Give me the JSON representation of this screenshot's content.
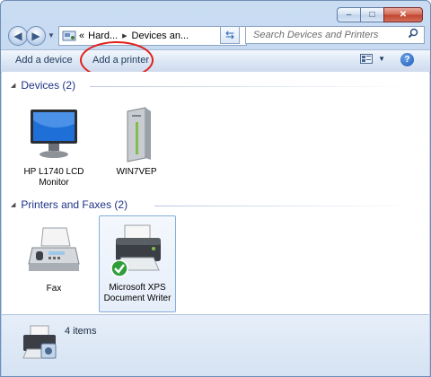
{
  "window": {
    "caption": {
      "minimize": "–",
      "maximize": "□",
      "close": "✕"
    }
  },
  "address_bar": {
    "prefix": "«",
    "crumbs": [
      "Hard...",
      "Devices an..."
    ],
    "search_placeholder": "Search Devices and Printers"
  },
  "toolbar": {
    "add_device": "Add a device",
    "add_printer": "Add a printer",
    "help": "?"
  },
  "groups": [
    {
      "title": "Devices (2)",
      "items": [
        {
          "label": "HP L1740 LCD Monitor",
          "icon": "monitor-icon"
        },
        {
          "label": "WIN7VEP",
          "icon": "computer-tower-icon"
        }
      ]
    },
    {
      "title": "Printers and Faxes (2)",
      "items": [
        {
          "label": "Fax",
          "icon": "fax-icon"
        },
        {
          "label": "Microsoft XPS Document Writer",
          "icon": "printer-icon",
          "default": true
        }
      ]
    }
  ],
  "status_bar": {
    "count": "4 items"
  },
  "colors": {
    "highlight": "#e0201a",
    "group_title": "#1e3287",
    "frame": "#b9d0ec"
  }
}
